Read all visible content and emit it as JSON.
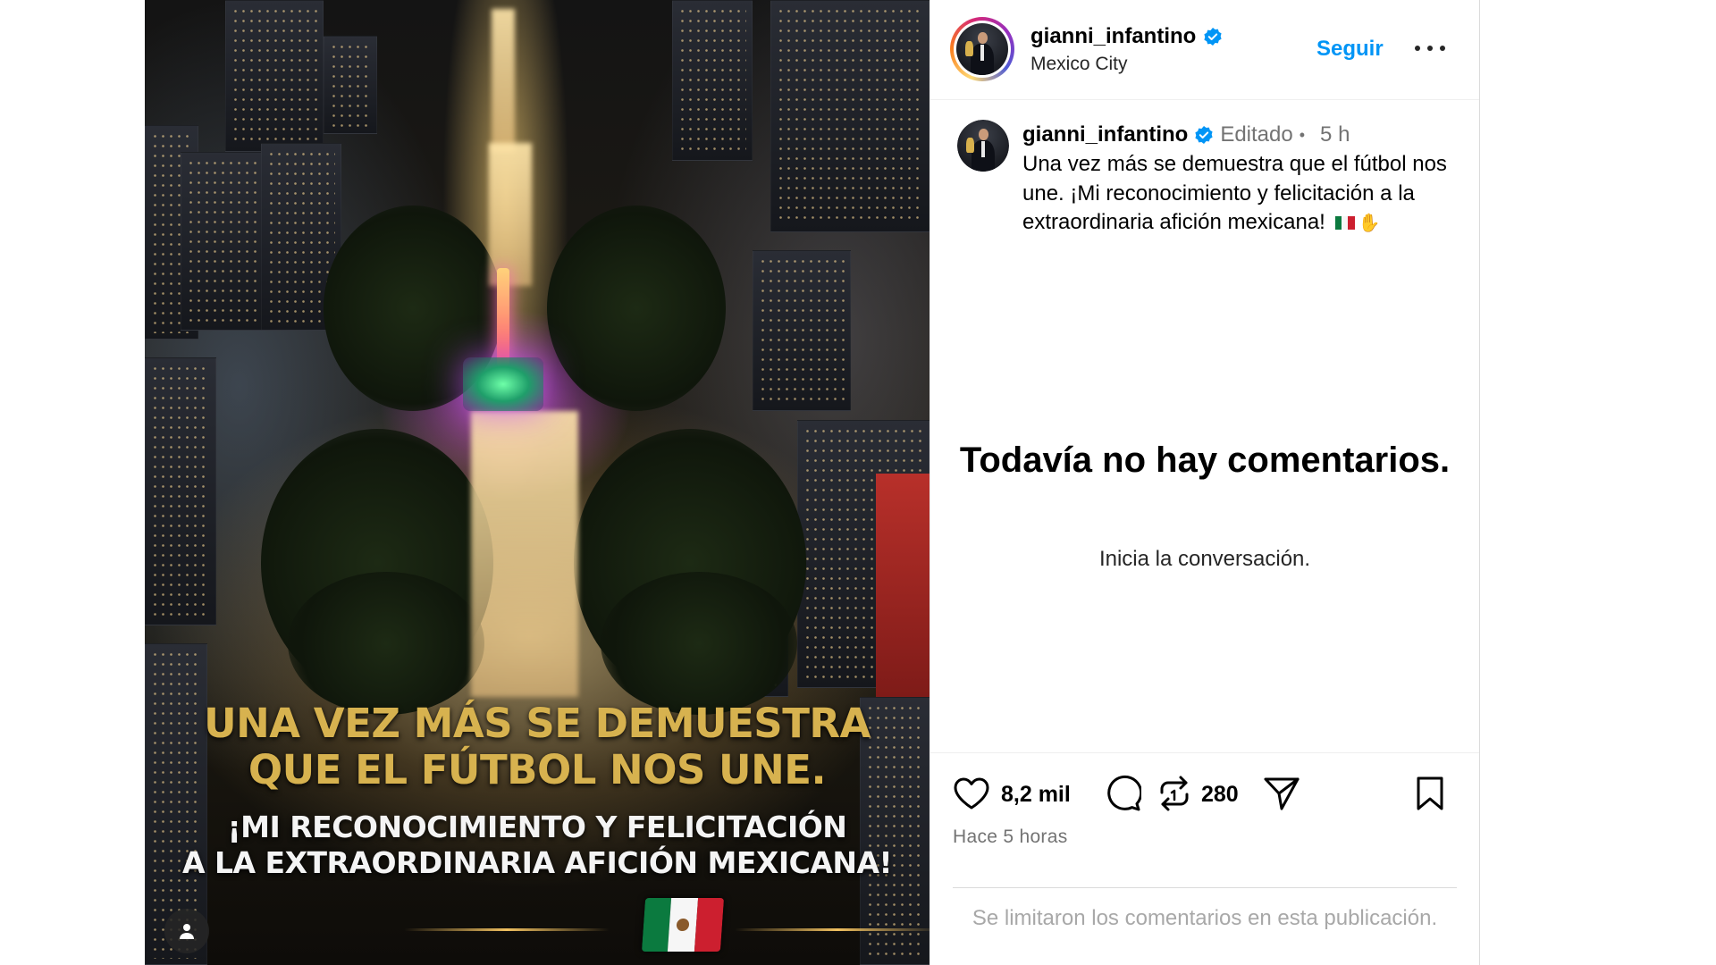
{
  "post_image": {
    "promo_line_1": "UNA VEZ MÁS SE DEMUESTRA",
    "promo_line_2": "QUE EL FÚTBOL NOS UNE.",
    "promo_line_3": "¡MI RECONOCIMIENTO Y FELICITACIÓN",
    "promo_line_4": "A LA EXTRAORDINARIA AFICIÓN MEXICANA!",
    "user_tags_icon": "person-icon"
  },
  "header": {
    "username": "gianni_infantino",
    "verified_icon": "verified-badge-icon",
    "location": "Mexico City",
    "follow_label": "Seguir",
    "more_icon": "more-options-icon"
  },
  "caption": {
    "username": "gianni_infantino",
    "edited_label": "Editado",
    "separator": "•",
    "time": "5 h",
    "text": "Una vez más se demuestra que el fútbol nos une. ¡Mi reconocimiento y felicitación a la extraordinaria afición mexicana!",
    "emojis": [
      "mexico-flag-emoji",
      "clapping-hands-emoji"
    ]
  },
  "comments": {
    "empty_title": "Todavía no hay comentarios.",
    "empty_subtitle": "Inicia la conversación."
  },
  "actions": {
    "like_icon": "heart-icon",
    "like_count": "8,2 mil",
    "comment_icon": "comment-icon",
    "repost_icon": "repost-icon",
    "repost_count": "280",
    "share_icon": "send-icon",
    "save_icon": "bookmark-icon"
  },
  "timestamp": "Hace 5 horas",
  "limited_comments_notice": "Se limitaron los comentarios en esta publicación.",
  "colors": {
    "follow_blue": "#0095f6",
    "verified_blue": "#0095f6",
    "muted_text": "#737373",
    "promo_gold": "#d7b24f"
  }
}
